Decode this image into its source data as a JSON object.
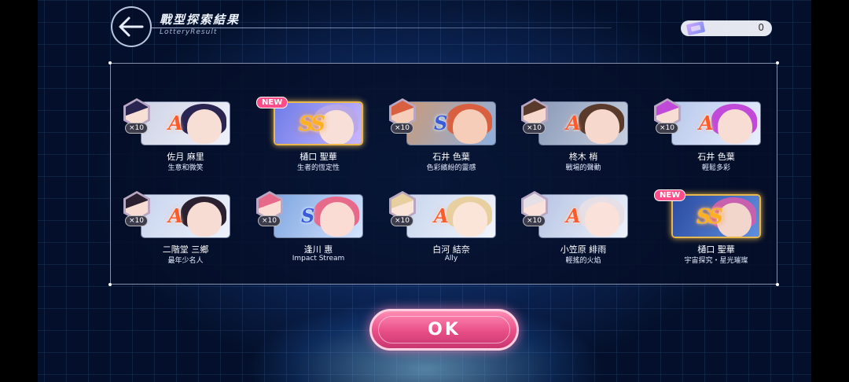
{
  "header": {
    "title": "戰型探索結果",
    "subtitle": "LotteryResult",
    "currency_value": "0",
    "back_icon": "arrow-left-icon",
    "currency_icon": "ticket-icon"
  },
  "cards": [
    {
      "name": "佐月 麻里",
      "skill": "生意和微笑",
      "rank": "A",
      "quantity": "×10",
      "new": false
    },
    {
      "name": "樋口 聖華",
      "skill": "生者的恆定性",
      "rank": "SS",
      "quantity": "",
      "new": true,
      "new_label": "NEW"
    },
    {
      "name": "石井 色葉",
      "skill": "色彩繽紛的靈感",
      "rank": "S",
      "quantity": "×10",
      "new": false
    },
    {
      "name": "柊木 梢",
      "skill": "戰場的聲動",
      "rank": "A",
      "quantity": "×10",
      "new": false
    },
    {
      "name": "石井 色葉",
      "skill": "輕鬆多彩",
      "rank": "A",
      "quantity": "×10",
      "new": false
    },
    {
      "name": "二階堂 三鄉",
      "skill": "最年少名人",
      "rank": "A",
      "quantity": "×10",
      "new": false
    },
    {
      "name": "逢川 惠",
      "skill": "Impact Stream",
      "rank": "S",
      "quantity": "×10",
      "new": false
    },
    {
      "name": "白河 結奈",
      "skill": "Ally",
      "rank": "A",
      "quantity": "×10",
      "new": false
    },
    {
      "name": "小笠原 緋雨",
      "skill": "輕搖的火焰",
      "rank": "A",
      "quantity": "×10",
      "new": false
    },
    {
      "name": "樋口 聖華",
      "skill": "宇宙探究・星光璀璨",
      "rank": "SS",
      "quantity": "",
      "new": true,
      "new_label": "NEW"
    }
  ],
  "ok_button": {
    "label": "OK"
  },
  "colors": {
    "accent_pink": "#e84e86",
    "rank_A": "#ff5a2a",
    "rank_S": "#3a5cd8",
    "rank_SS": "#ffb020"
  }
}
